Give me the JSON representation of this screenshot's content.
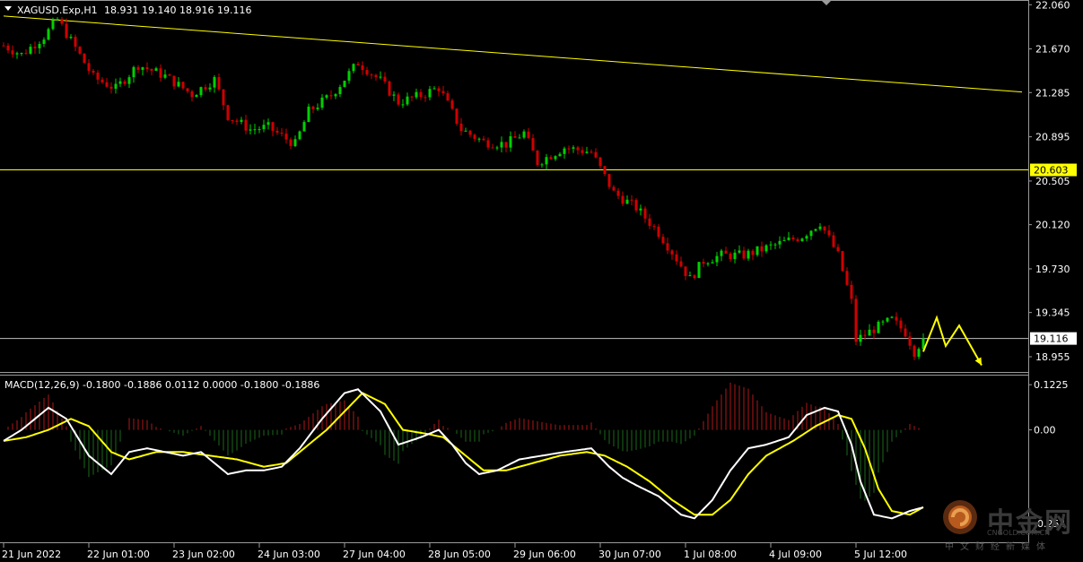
{
  "header": {
    "symbol": "XAGUSD.Exp,H1",
    "ohlc": "18.931 19.140 18.916 19.116"
  },
  "indicator_label": "MACD(12,26,9) -0.1800 -0.1886 0.0112 0.0000 -0.1800 -0.1886",
  "colors": {
    "background": "#000000",
    "bull": "#00d000",
    "bear": "#d00000",
    "trend": "#ffff00",
    "macd_line": "#ffffff",
    "signal_line": "#ffff00",
    "hist_up": "#b01818",
    "hist_down": "#1a6a1a",
    "price_tag": "#ffff00"
  },
  "watermark": {
    "name": "中金网",
    "url": "CNGOLD.COM.CN",
    "tagline": "中文财经新媒体"
  },
  "chart_data": [
    {
      "type": "candlestick",
      "title": "XAGUSD.Exp,H1",
      "price_ticks": [
        "22.060",
        "21.670",
        "21.285",
        "20.895",
        "20.505",
        "20.120",
        "19.730",
        "19.345",
        "18.955"
      ],
      "price_tick_values": [
        22.06,
        21.67,
        21.285,
        20.895,
        20.505,
        20.12,
        19.73,
        19.345,
        18.955
      ],
      "ylim": [
        18.86,
        22.07
      ],
      "horizontal_levels": [
        {
          "label": "20.603",
          "value": 20.603,
          "color": "#ffff00"
        },
        {
          "label": "19.116",
          "value": 19.116,
          "color": "#c0c0c0"
        }
      ],
      "trendline": {
        "from": [
          0,
          21.96
        ],
        "to": [
          227,
          21.29
        ]
      },
      "time_labels": [
        "21 Jun 2022",
        "22 Jun 01:00",
        "23 Jun 02:00",
        "24 Jun 03:00",
        "27 Jun 04:00",
        "28 Jun 05:00",
        "29 Jun 06:00",
        "30 Jun 07:00",
        "1 Jul 08:00",
        "4 Jul 09:00",
        "5 Jul 12:00"
      ],
      "time_label_bars": [
        0,
        19,
        38,
        57,
        76,
        95,
        114,
        133,
        152,
        171,
        190
      ],
      "close_path": [
        [
          0,
          21.7
        ],
        [
          4,
          21.62
        ],
        [
          9,
          21.78
        ],
        [
          12,
          21.93
        ],
        [
          16,
          21.68
        ],
        [
          20,
          21.42
        ],
        [
          25,
          21.32
        ],
        [
          30,
          21.53
        ],
        [
          36,
          21.43
        ],
        [
          42,
          21.27
        ],
        [
          47,
          21.4
        ],
        [
          50,
          21.08
        ],
        [
          55,
          20.96
        ],
        [
          59,
          20.98
        ],
        [
          62,
          20.9
        ],
        [
          65,
          20.83
        ],
        [
          68,
          21.12
        ],
        [
          73,
          21.26
        ],
        [
          79,
          21.55
        ],
        [
          84,
          21.39
        ],
        [
          88,
          21.2
        ],
        [
          93,
          21.26
        ],
        [
          97,
          21.33
        ],
        [
          102,
          20.96
        ],
        [
          107,
          20.85
        ],
        [
          112,
          20.83
        ],
        [
          116,
          20.93
        ],
        [
          119,
          20.67
        ],
        [
          125,
          20.8
        ],
        [
          131,
          20.76
        ],
        [
          136,
          20.4
        ],
        [
          141,
          20.27
        ],
        [
          146,
          20.05
        ],
        [
          149,
          19.88
        ],
        [
          153,
          19.64
        ],
        [
          156,
          19.8
        ],
        [
          160,
          19.85
        ],
        [
          165,
          19.85
        ],
        [
          172,
          19.94
        ],
        [
          178,
          20.02
        ],
        [
          182,
          20.14
        ],
        [
          186,
          19.85
        ],
        [
          189,
          19.44
        ],
        [
          190,
          19.1
        ],
        [
          194,
          19.2
        ],
        [
          198,
          19.28
        ],
        [
          201,
          19.17
        ],
        [
          203,
          19.0
        ],
        [
          205,
          19.116
        ]
      ],
      "forecast_arrows": [
        [
          [
            205,
            19.0
          ],
          [
            208,
            19.3
          ],
          [
            210,
            19.05
          ],
          [
            213,
            19.23
          ],
          [
            218,
            18.88
          ]
        ]
      ]
    },
    {
      "type": "macd",
      "title": "MACD(12,26,9)",
      "params": [
        12,
        26,
        9
      ],
      "values": {
        "macd": -0.18,
        "signal": -0.1886,
        "histogram": 0.0112
      },
      "y_ticks": [
        "0.1225",
        "0.00",
        "-0.254"
      ],
      "y_tick_values": [
        0.1225,
        0.0,
        -0.254
      ],
      "ylim": [
        -0.3,
        0.14
      ],
      "macd_path": [
        [
          0,
          -0.03
        ],
        [
          4,
          0.0
        ],
        [
          10,
          0.06
        ],
        [
          14,
          0.03
        ],
        [
          19,
          -0.07
        ],
        [
          24,
          -0.12
        ],
        [
          28,
          -0.06
        ],
        [
          32,
          -0.05
        ],
        [
          36,
          -0.06
        ],
        [
          40,
          -0.07
        ],
        [
          44,
          -0.06
        ],
        [
          47,
          -0.09
        ],
        [
          50,
          -0.12
        ],
        [
          54,
          -0.11
        ],
        [
          58,
          -0.11
        ],
        [
          62,
          -0.1
        ],
        [
          66,
          -0.05
        ],
        [
          71,
          0.03
        ],
        [
          76,
          0.1
        ],
        [
          79,
          0.11
        ],
        [
          84,
          0.05
        ],
        [
          88,
          -0.04
        ],
        [
          93,
          -0.02
        ],
        [
          97,
          0.0
        ],
        [
          100,
          -0.04
        ],
        [
          103,
          -0.09
        ],
        [
          106,
          -0.12
        ],
        [
          110,
          -0.11
        ],
        [
          115,
          -0.08
        ],
        [
          120,
          -0.07
        ],
        [
          125,
          -0.06
        ],
        [
          131,
          -0.05
        ],
        [
          135,
          -0.1
        ],
        [
          138,
          -0.13
        ],
        [
          141,
          -0.15
        ],
        [
          146,
          -0.18
        ],
        [
          151,
          -0.23
        ],
        [
          154,
          -0.24
        ],
        [
          158,
          -0.19
        ],
        [
          162,
          -0.11
        ],
        [
          166,
          -0.05
        ],
        [
          170,
          -0.04
        ],
        [
          175,
          -0.02
        ],
        [
          179,
          0.04
        ],
        [
          183,
          0.06
        ],
        [
          186,
          0.05
        ],
        [
          189,
          -0.04
        ],
        [
          191,
          -0.14
        ],
        [
          194,
          -0.23
        ],
        [
          198,
          -0.24
        ],
        [
          202,
          -0.22
        ],
        [
          205,
          -0.21
        ]
      ],
      "signal_path": [
        [
          0,
          -0.03
        ],
        [
          5,
          -0.02
        ],
        [
          10,
          0.0
        ],
        [
          15,
          0.03
        ],
        [
          19,
          0.01
        ],
        [
          24,
          -0.06
        ],
        [
          28,
          -0.08
        ],
        [
          34,
          -0.06
        ],
        [
          40,
          -0.06
        ],
        [
          46,
          -0.07
        ],
        [
          52,
          -0.08
        ],
        [
          58,
          -0.1
        ],
        [
          63,
          -0.09
        ],
        [
          68,
          -0.04
        ],
        [
          72,
          0.0
        ],
        [
          76,
          0.05
        ],
        [
          80,
          0.1
        ],
        [
          85,
          0.07
        ],
        [
          89,
          0.0
        ],
        [
          94,
          -0.01
        ],
        [
          98,
          -0.02
        ],
        [
          103,
          -0.07
        ],
        [
          107,
          -0.11
        ],
        [
          112,
          -0.11
        ],
        [
          118,
          -0.09
        ],
        [
          124,
          -0.07
        ],
        [
          130,
          -0.06
        ],
        [
          134,
          -0.07
        ],
        [
          139,
          -0.1
        ],
        [
          144,
          -0.14
        ],
        [
          149,
          -0.19
        ],
        [
          154,
          -0.23
        ],
        [
          158,
          -0.23
        ],
        [
          162,
          -0.19
        ],
        [
          166,
          -0.12
        ],
        [
          170,
          -0.07
        ],
        [
          176,
          -0.03
        ],
        [
          181,
          0.01
        ],
        [
          186,
          0.04
        ],
        [
          189,
          0.03
        ],
        [
          192,
          -0.05
        ],
        [
          195,
          -0.16
        ],
        [
          198,
          -0.22
        ],
        [
          202,
          -0.23
        ],
        [
          205,
          -0.21
        ]
      ]
    }
  ]
}
